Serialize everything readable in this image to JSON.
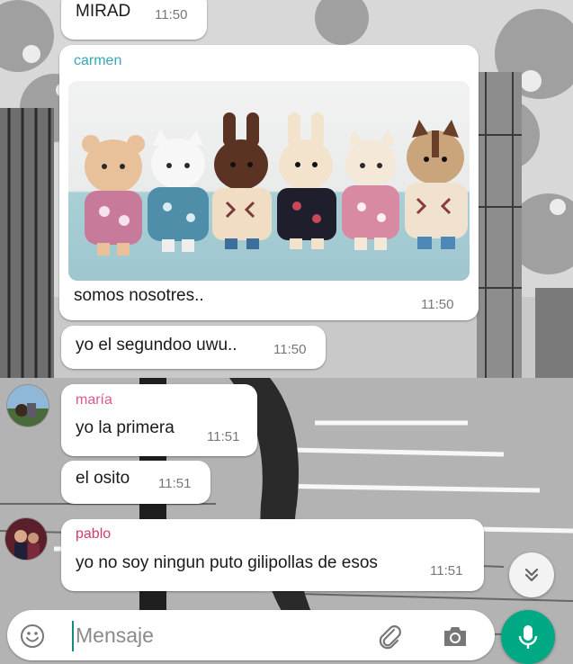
{
  "colors": {
    "accent_green": "#00a884",
    "sender_carmen": "#35a7b8",
    "sender_maria": "#e0578f",
    "sender_pablo": "#d23b6a",
    "bubble_bg": "#ffffff",
    "time_gray": "#777777"
  },
  "messages": [
    {
      "text": "MIRAD",
      "time": "11:50"
    },
    {
      "sender": "carmen",
      "image": "plush-toys-photo",
      "text": "somos nosotres..",
      "time": "11:50"
    },
    {
      "text": "yo el segundoo uwu..",
      "time": "11:50"
    },
    {
      "sender": "maría",
      "avatar": "maria-avatar",
      "text": "yo la primera",
      "time": "11:51"
    },
    {
      "text": "el osito",
      "time": "11:51"
    },
    {
      "sender": "pablo",
      "avatar": "pablo-avatar",
      "text": "yo no soy ningun puto gilipollas de esos",
      "time": "11:51"
    }
  ],
  "input": {
    "placeholder": "Mensaje",
    "emoji_icon": "emoji-icon",
    "attach_icon": "paperclip-icon",
    "camera_icon": "camera-icon",
    "mic_icon": "microphone-icon"
  },
  "scroll_button_icon": "double-chevron-down-icon"
}
